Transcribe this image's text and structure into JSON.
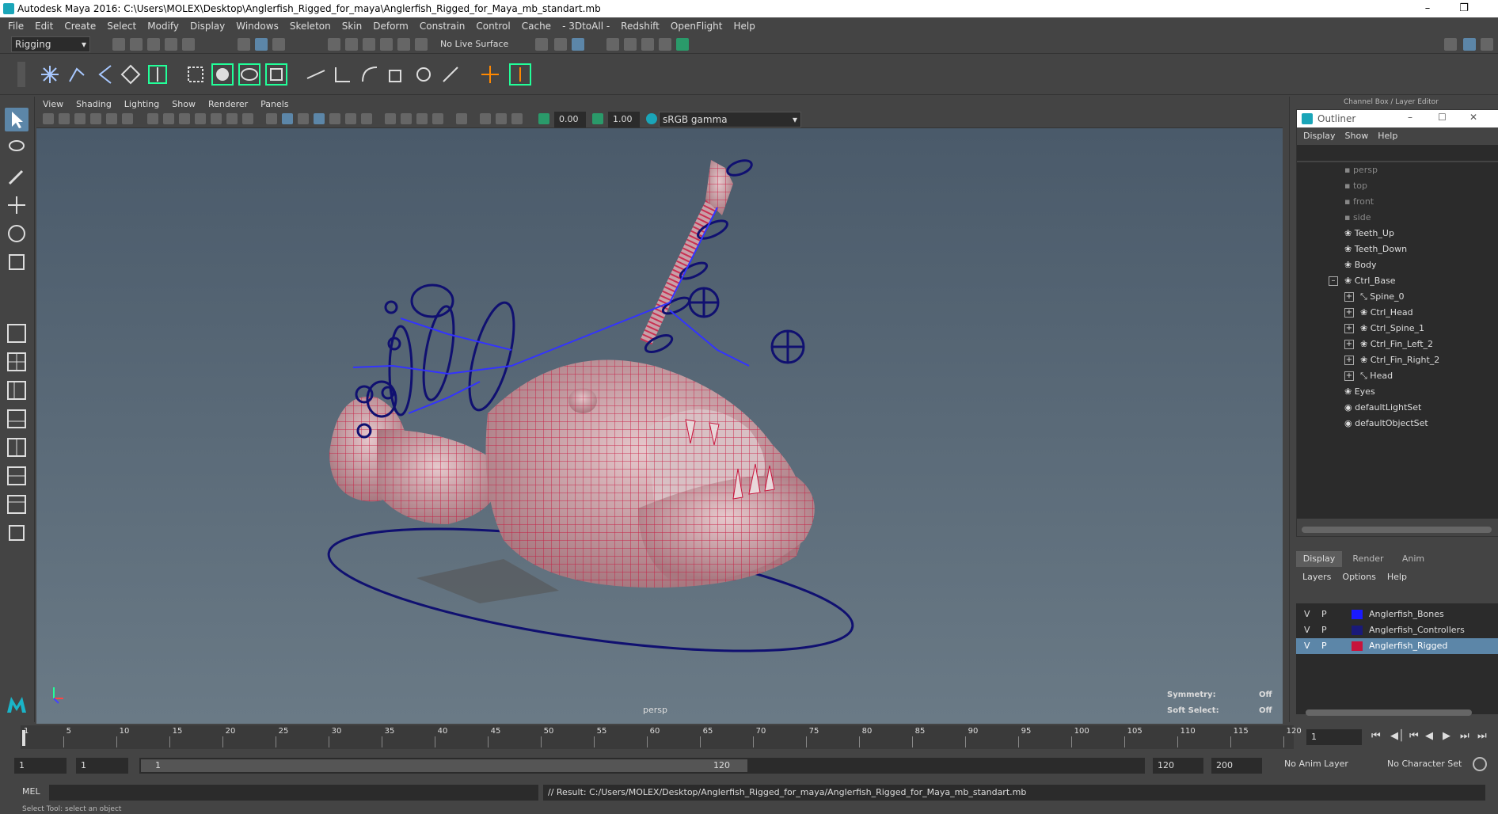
{
  "window": {
    "title": "Autodesk Maya 2016: C:\\Users\\MOLEX\\Desktop\\Anglerfish_Rigged_for_maya\\Anglerfish_Rigged_for_Maya_mb_standart.mb",
    "minimize_icon": "minimize-icon",
    "restore_icon": "restore-icon",
    "close_icon": "close-icon"
  },
  "menubar": [
    "File",
    "Edit",
    "Create",
    "Select",
    "Modify",
    "Display",
    "Windows",
    "Skeleton",
    "Skin",
    "Deform",
    "Constrain",
    "Control",
    "Cache",
    "- 3DtoAll -",
    "Redshift",
    "OpenFlight",
    "Help"
  ],
  "statusline": {
    "menuset": "Rigging",
    "live_surface": "No Live Surface"
  },
  "panel": {
    "menus": [
      "View",
      "Shading",
      "Lighting",
      "Show",
      "Renderer",
      "Panels"
    ],
    "exposure": "0.00",
    "gamma": "1.00",
    "colorspace": "sRGB gamma",
    "camera_label": "persp",
    "symmetry_label": "Symmetry:",
    "symmetry_value": "Off",
    "softselect_label": "Soft Select:",
    "softselect_value": "Off"
  },
  "rightpanel": {
    "header": "Channel Box / Layer Editor",
    "outliner": {
      "title": "Outliner",
      "menus": [
        "Display",
        "Show",
        "Help"
      ],
      "items": [
        {
          "label": "persp",
          "dim": true
        },
        {
          "label": "top",
          "dim": true
        },
        {
          "label": "front",
          "dim": true
        },
        {
          "label": "side",
          "dim": true
        },
        {
          "label": "Teeth_Up",
          "dim": false
        },
        {
          "label": "Teeth_Down",
          "dim": false
        },
        {
          "label": "Body",
          "dim": false
        },
        {
          "label": "Ctrl_Base",
          "dim": false
        },
        {
          "label": "Spine_0",
          "dim": false
        },
        {
          "label": "Ctrl_Head",
          "dim": false
        },
        {
          "label": "Ctrl_Spine_1",
          "dim": false
        },
        {
          "label": "Ctrl_Fin_Left_2",
          "dim": false
        },
        {
          "label": "Ctrl_Fin_Right_2",
          "dim": false
        },
        {
          "label": "Head",
          "dim": false
        },
        {
          "label": "Eyes",
          "dim": false
        },
        {
          "label": "defaultLightSet",
          "dim": false
        },
        {
          "label": "defaultObjectSet",
          "dim": false
        }
      ]
    },
    "tabs": [
      "Display",
      "Render",
      "Anim"
    ],
    "layer_menus": [
      "Layers",
      "Options",
      "Help"
    ],
    "layers": [
      {
        "v": "V",
        "p": "P",
        "color": "#1a1aff",
        "name": "Anglerfish_Bones"
      },
      {
        "v": "V",
        "p": "P",
        "color": "#1a1a7a",
        "name": "Anglerfish_Controllers"
      },
      {
        "v": "V",
        "p": "P",
        "color": "#c8143c",
        "name": "Anglerfish_Rigged"
      }
    ]
  },
  "timeline": {
    "ticks": [
      "5",
      "10",
      "15",
      "20",
      "25",
      "30",
      "35",
      "40",
      "45",
      "50",
      "55",
      "60",
      "65",
      "70",
      "75",
      "80",
      "85",
      "90",
      "95",
      "100",
      "105",
      "110",
      "115",
      "120"
    ],
    "first": "1",
    "current_frame": "1"
  },
  "rangebar": {
    "start": "1",
    "start2": "1",
    "range_start": "1",
    "range_end": "120",
    "end": "120",
    "end2": "200",
    "anim_layer": "No Anim Layer",
    "char_set": "No Character Set"
  },
  "cmdline": {
    "lang": "MEL",
    "result": "// Result: C:/Users/MOLEX/Desktop/Anglerfish_Rigged_for_maya/Anglerfish_Rigged_for_Maya_mb_standart.mb"
  },
  "helpline": "Select Tool: select an object"
}
